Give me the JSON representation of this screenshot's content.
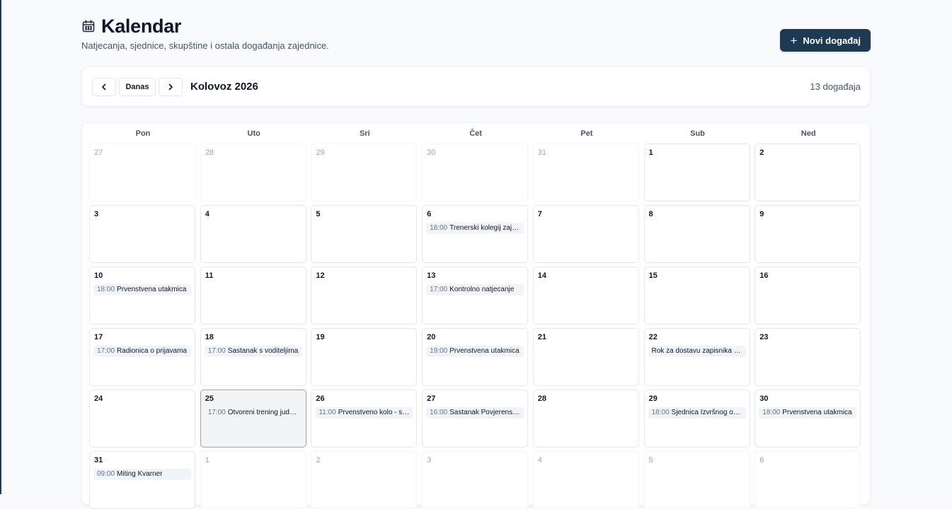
{
  "header": {
    "title": "Kalendar",
    "subtitle": "Natjecanja, sjednice, skupštine i ostala događanja zajednice.",
    "new_event_label": "Novi događaj"
  },
  "toolbar": {
    "today_label": "Danas",
    "month_title": "Kolovoz 2026",
    "event_count": "13 događaja"
  },
  "calendar": {
    "weekdays": [
      "Pon",
      "Uto",
      "Sri",
      "Čet",
      "Pet",
      "Sub",
      "Ned"
    ],
    "days": [
      {
        "num": "27",
        "outside": true,
        "today": false
      },
      {
        "num": "28",
        "outside": true,
        "today": false
      },
      {
        "num": "29",
        "outside": true,
        "today": false
      },
      {
        "num": "30",
        "outside": true,
        "today": false
      },
      {
        "num": "31",
        "outside": true,
        "today": false
      },
      {
        "num": "1",
        "outside": false,
        "today": false
      },
      {
        "num": "2",
        "outside": false,
        "today": false
      },
      {
        "num": "3",
        "outside": false,
        "today": false
      },
      {
        "num": "4",
        "outside": false,
        "today": false
      },
      {
        "num": "5",
        "outside": false,
        "today": false
      },
      {
        "num": "6",
        "outside": false,
        "today": false,
        "event": {
          "time": "18:00",
          "title": "Trenerski kolegij zajednice"
        }
      },
      {
        "num": "7",
        "outside": false,
        "today": false
      },
      {
        "num": "8",
        "outside": false,
        "today": false
      },
      {
        "num": "9",
        "outside": false,
        "today": false
      },
      {
        "num": "10",
        "outside": false,
        "today": false,
        "event": {
          "time": "18:00",
          "title": "Prvenstvena utakmica"
        }
      },
      {
        "num": "11",
        "outside": false,
        "today": false
      },
      {
        "num": "12",
        "outside": false,
        "today": false
      },
      {
        "num": "13",
        "outside": false,
        "today": false,
        "event": {
          "time": "17:00",
          "title": "Kontrolno natjecanje"
        }
      },
      {
        "num": "14",
        "outside": false,
        "today": false
      },
      {
        "num": "15",
        "outside": false,
        "today": false
      },
      {
        "num": "16",
        "outside": false,
        "today": false
      },
      {
        "num": "17",
        "outside": false,
        "today": false,
        "event": {
          "time": "17:00",
          "title": "Radionica o prijavama"
        }
      },
      {
        "num": "18",
        "outside": false,
        "today": false,
        "event": {
          "time": "17:00",
          "title": "Sastanak s voditeljima"
        }
      },
      {
        "num": "19",
        "outside": false,
        "today": false
      },
      {
        "num": "20",
        "outside": false,
        "today": false,
        "event": {
          "time": "19:00",
          "title": "Prvenstvena utakmica"
        }
      },
      {
        "num": "21",
        "outside": false,
        "today": false
      },
      {
        "num": "22",
        "outside": false,
        "today": false,
        "event": {
          "time": "",
          "title": "Rok za dostavu zapisnika sjednica"
        }
      },
      {
        "num": "23",
        "outside": false,
        "today": false
      },
      {
        "num": "24",
        "outside": false,
        "today": false
      },
      {
        "num": "25",
        "outside": false,
        "today": true,
        "event": {
          "time": "17:00",
          "title": "Otvoreni trening juda za djecu"
        }
      },
      {
        "num": "26",
        "outside": false,
        "today": false,
        "event": {
          "time": "11:00",
          "title": "Prvenstveno kolo - seniori"
        }
      },
      {
        "num": "27",
        "outside": false,
        "today": false,
        "event": {
          "time": "16:00",
          "title": "Sastanak Povjerenstva"
        }
      },
      {
        "num": "28",
        "outside": false,
        "today": false
      },
      {
        "num": "29",
        "outside": false,
        "today": false,
        "event": {
          "time": "18:00",
          "title": "Sjednica Izvršnog odbora"
        }
      },
      {
        "num": "30",
        "outside": false,
        "today": false,
        "event": {
          "time": "18:00",
          "title": "Prvenstvena utakmica"
        }
      },
      {
        "num": "31",
        "outside": false,
        "today": false,
        "event": {
          "time": "09:00",
          "title": "Miting Kvarner"
        }
      },
      {
        "num": "1",
        "outside": true,
        "today": false
      },
      {
        "num": "2",
        "outside": true,
        "today": false
      },
      {
        "num": "3",
        "outside": true,
        "today": false
      },
      {
        "num": "4",
        "outside": true,
        "today": false
      },
      {
        "num": "5",
        "outside": true,
        "today": false
      },
      {
        "num": "6",
        "outside": true,
        "today": false
      }
    ]
  },
  "colors": {
    "primary": "#1e3a52",
    "today_bg": "#f3f4f6",
    "chip_bg": "#f1f5f9"
  },
  "icons": {
    "title": "calendar-icon",
    "prev": "chevron-left-icon",
    "next": "chevron-right-icon",
    "add": "plus-icon"
  }
}
